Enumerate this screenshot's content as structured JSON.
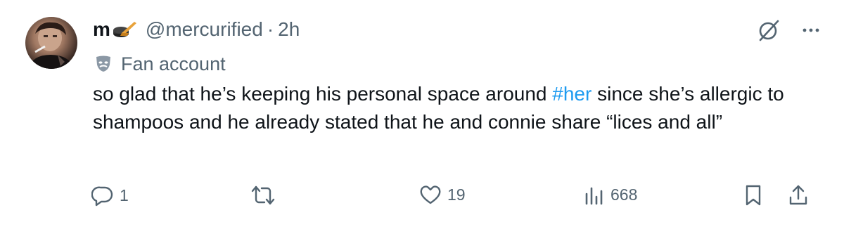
{
  "author": {
    "display_name": "m",
    "handle": "@mercurified",
    "separator": "·",
    "time": "2h",
    "label": "Fan account"
  },
  "tweet": {
    "text_before": "so glad that he’s keeping his personal space around ",
    "hashtag": "#her",
    "text_after": " since she’s allergic to shampoos and he already stated that he and connie share  “lices and all”"
  },
  "actions": {
    "replies": "1",
    "retweets": "",
    "likes": "19",
    "views": "668"
  },
  "icons": {
    "reply": "reply-icon",
    "retweet": "retweet-icon",
    "like": "heart-icon",
    "views": "views-icon",
    "bookmark": "bookmark-icon",
    "share": "share-icon",
    "grok": "grok-icon",
    "more": "more-icon",
    "label": "theater-mask-icon"
  },
  "colors": {
    "text": "#0f1419",
    "muted": "#536471",
    "link": "#1d9bf0"
  }
}
